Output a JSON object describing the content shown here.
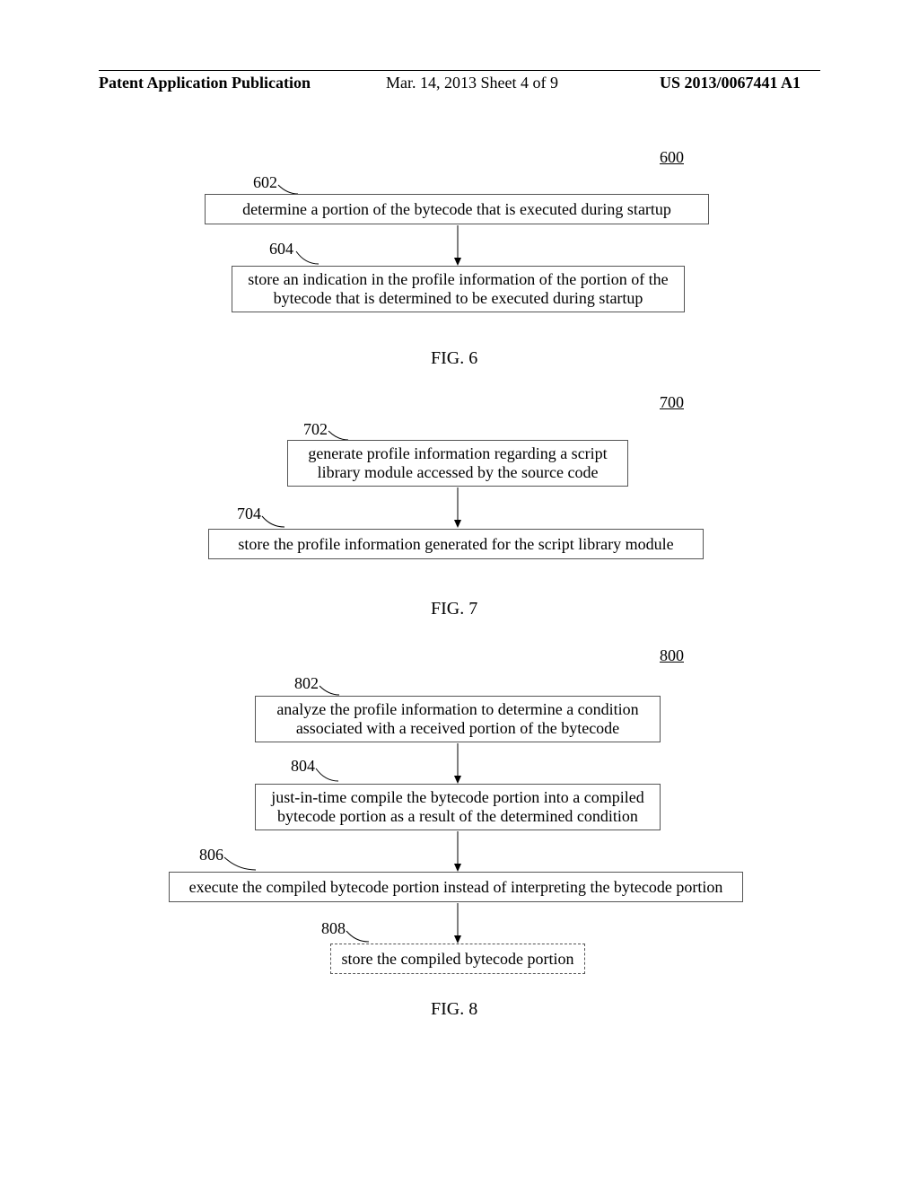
{
  "header": {
    "left": "Patent Application Publication",
    "center": "Mar. 14, 2013  Sheet 4 of 9",
    "right": "US 2013/0067441 A1"
  },
  "fig6": {
    "ref": "600",
    "label602": "602",
    "box602": "determine a portion of the bytecode that is executed during startup",
    "label604": "604",
    "box604": "store an indication in the profile information of the portion of the bytecode that is determined to be executed during startup",
    "caption": "FIG. 6"
  },
  "fig7": {
    "ref": "700",
    "label702": "702",
    "box702": "generate profile information regarding a script library module accessed by the source code",
    "label704": "704",
    "box704": "store the profile information generated for the script library module",
    "caption": "FIG. 7"
  },
  "fig8": {
    "ref": "800",
    "label802": "802",
    "box802": "analyze the profile information to determine a condition associated with a received portion of the bytecode",
    "label804": "804",
    "box804": "just-in-time compile the bytecode portion into a compiled bytecode portion as a result of the determined condition",
    "label806": "806",
    "box806": "execute the compiled bytecode portion instead of interpreting the bytecode portion",
    "label808": "808",
    "box808": "store the compiled bytecode portion",
    "caption": "FIG. 8"
  }
}
